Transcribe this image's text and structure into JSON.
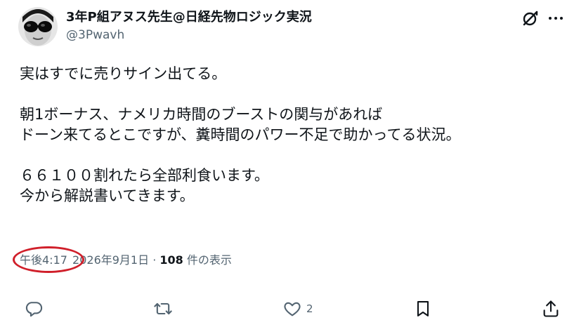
{
  "post": {
    "author": {
      "display_name": "3年P組アヌス先生@日経先物ロジック実況",
      "handle": "@3Pwavh"
    },
    "body_lines": [
      "実はすでに売りサイン出てる。",
      "",
      "朝1ボーナス、ナメリカ時間のブーストの関与があれば",
      "ドーン来てるとこですが、糞時間のパワー不足で助かってる状況。",
      "",
      "６６１００割れたら全部利食います。",
      "今から解説書いてきます。"
    ],
    "meta": {
      "time": "午後4:17",
      "date": "2026年9月1日",
      "separator": "·",
      "views_count": "108",
      "views_label": "件の表示"
    },
    "actions": {
      "reply_icon": "reply-icon",
      "repost_icon": "repost-icon",
      "like_icon": "like-icon",
      "like_count": "2",
      "bookmark_icon": "bookmark-icon",
      "share_icon": "share-icon"
    },
    "header_icons": [
      "grok-icon",
      "more-icon"
    ],
    "colors": {
      "text": "#0f1419",
      "secondary": "#536471",
      "highlight": "#d01f2a"
    }
  }
}
